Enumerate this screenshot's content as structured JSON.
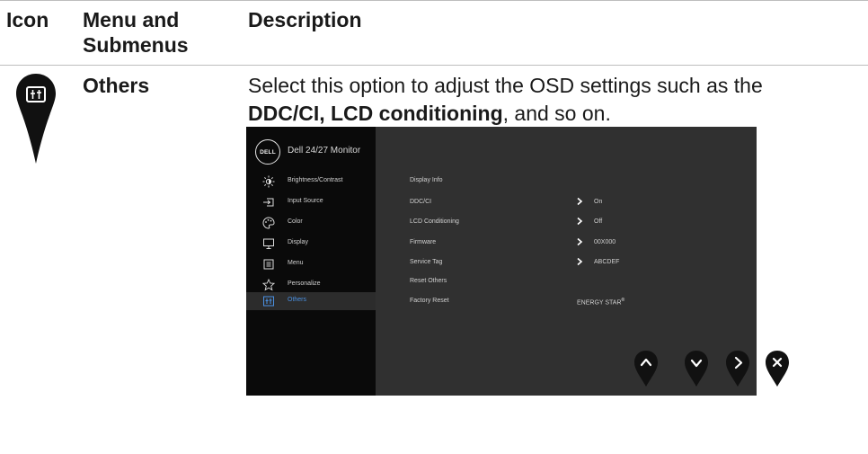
{
  "table": {
    "headers": {
      "icon": "Icon",
      "menu": "Menu and Submenus",
      "description": "Description"
    }
  },
  "section": {
    "icon": "others-icon",
    "name": "Others",
    "description_prefix": "Select this option to adjust the OSD settings such as the ",
    "description_bold": "DDC/CI, LCD conditioning",
    "description_suffix": ", and so on."
  },
  "osd": {
    "logo": "DELL",
    "title": "Dell 24/27 Monitor",
    "menu_items": [
      {
        "label": "Brightness/Contrast",
        "icon": "brightness-icon",
        "active": false
      },
      {
        "label": "Input Source",
        "icon": "input-source-icon",
        "active": false
      },
      {
        "label": "Color",
        "icon": "color-palette-icon",
        "active": false
      },
      {
        "label": "Display",
        "icon": "display-monitor-icon",
        "active": false
      },
      {
        "label": "Menu",
        "icon": "menu-icon",
        "active": false
      },
      {
        "label": "Personalize",
        "icon": "star-icon",
        "active": false
      },
      {
        "label": "Others",
        "icon": "others-icon",
        "active": true
      }
    ],
    "rows": [
      {
        "label": "Display Info",
        "chevron": false,
        "value": ""
      },
      {
        "label": "DDC/CI",
        "chevron": true,
        "value": "On"
      },
      {
        "label": "LCD Conditioning",
        "chevron": true,
        "value": "Off"
      },
      {
        "label": "Firmware",
        "chevron": true,
        "value": "00X000"
      },
      {
        "label": "Service Tag",
        "chevron": true,
        "value": "ABCDEF"
      },
      {
        "label": "Reset Others",
        "chevron": false,
        "value": ""
      },
      {
        "label": "Factory Reset",
        "chevron": false,
        "value": ""
      }
    ],
    "energy_star": "ENERGY STAR",
    "energy_star_mark": "®"
  },
  "nav_buttons": [
    {
      "icon": "chevron-up-icon"
    },
    {
      "icon": "chevron-down-icon"
    },
    {
      "icon": "chevron-right-icon"
    },
    {
      "icon": "close-icon"
    }
  ],
  "colors": {
    "osd_background": "#303030",
    "osd_sidebar": "#0a0a0a",
    "active_item": "#4a90e2",
    "pin": "#111111"
  }
}
